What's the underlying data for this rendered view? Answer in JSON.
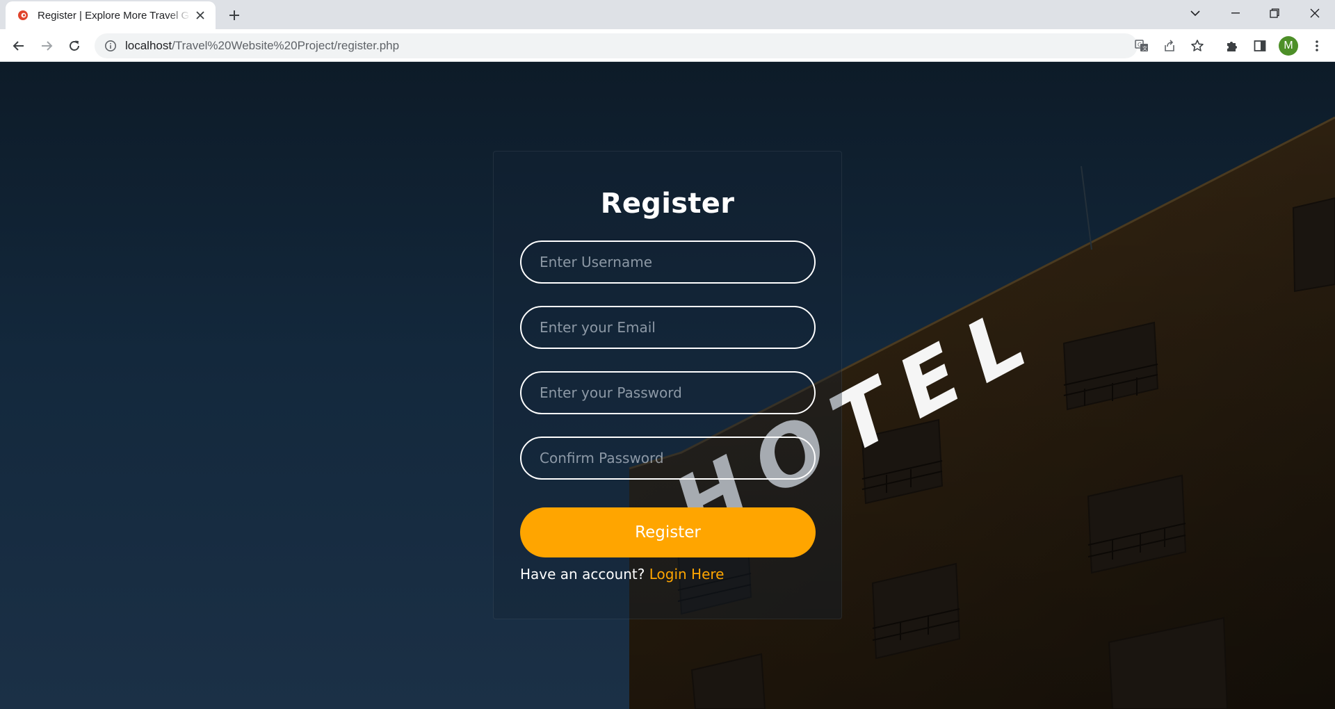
{
  "browser": {
    "tab_title": "Register | Explore More Travel Guide",
    "url_host": "localhost",
    "url_path": "/Travel%20Website%20Project/register.php",
    "profile_initial": "M"
  },
  "scene": {
    "sign_text": "HOTEL"
  },
  "form": {
    "title": "Register",
    "username_placeholder": "Enter Username",
    "email_placeholder": "Enter your Email",
    "password_placeholder": "Enter your Password",
    "confirm_placeholder": "Confirm Password",
    "submit_label": "Register",
    "account_prompt": "Have an account?",
    "login_link": "Login Here"
  },
  "colors": {
    "accent": "#ffa500",
    "chrome": "#dee1e6"
  }
}
